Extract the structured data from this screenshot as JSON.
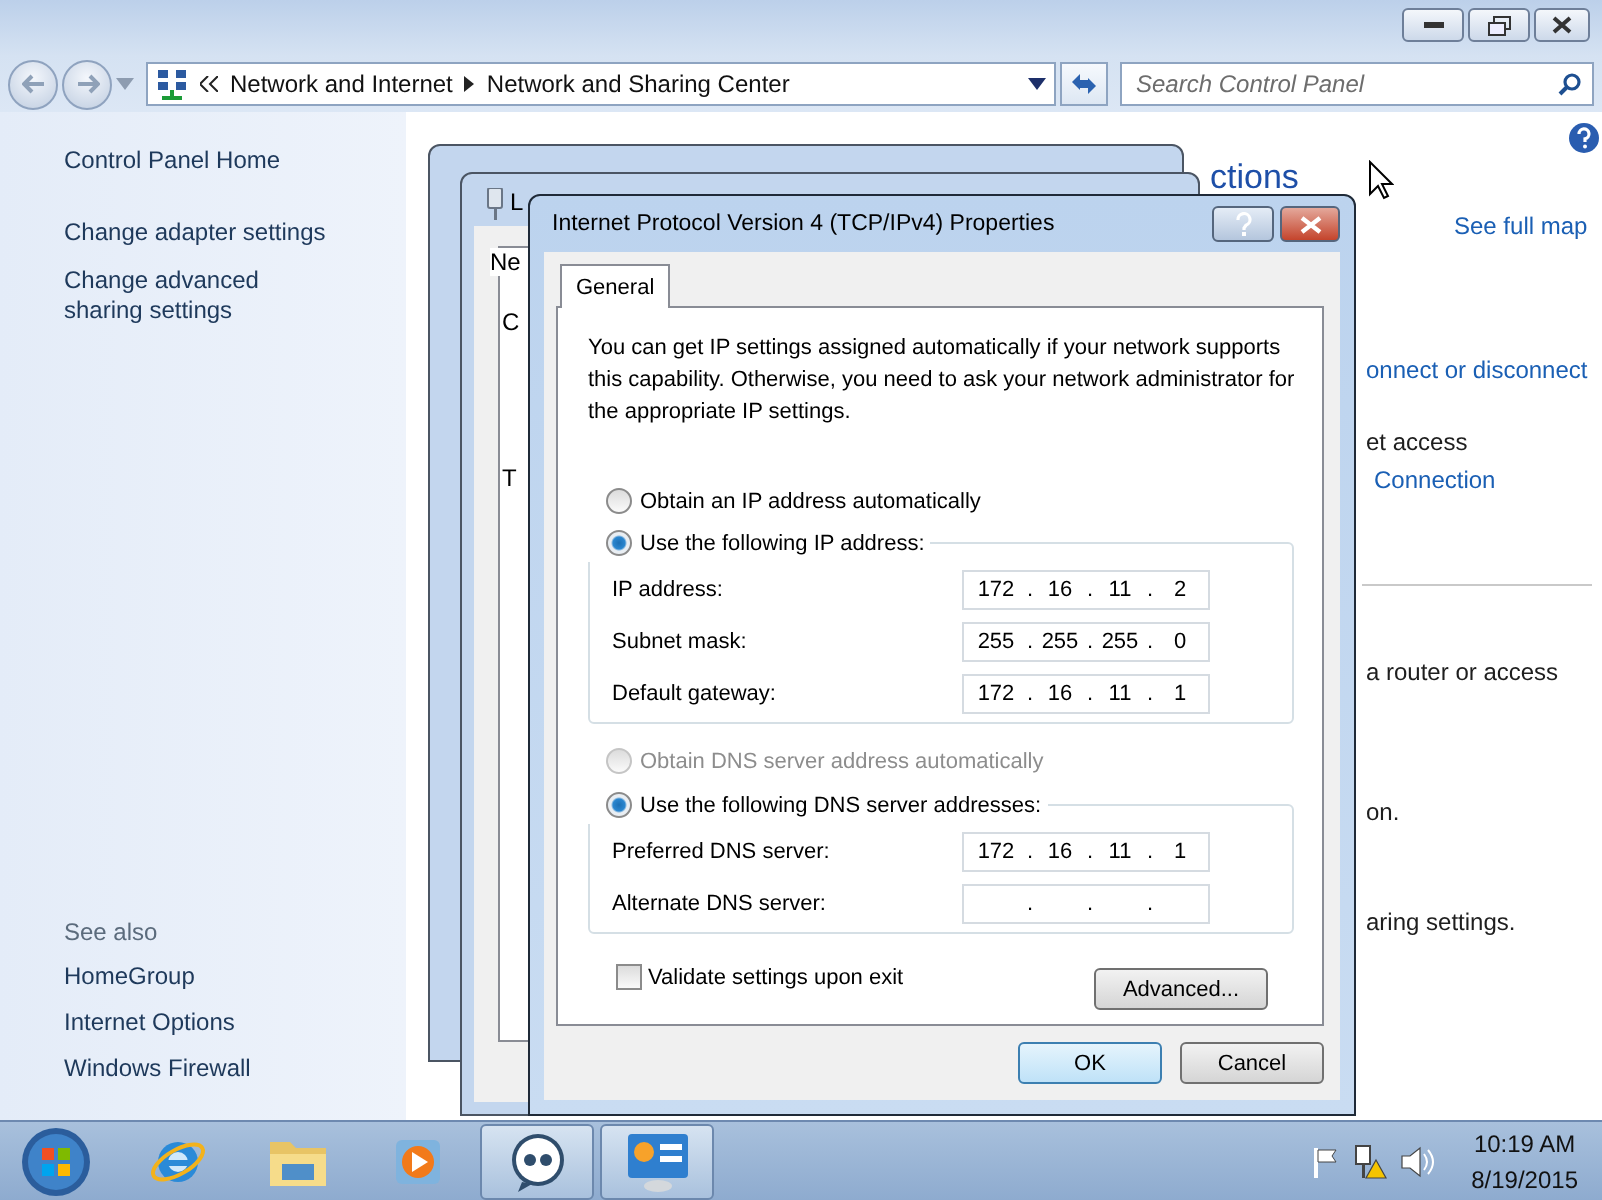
{
  "explorer": {
    "breadcrumb": [
      "Network and Internet",
      "Network and Sharing Center"
    ],
    "search": {
      "placeholder": "Search Control Panel"
    },
    "sidebar": {
      "links": [
        "Control Panel Home",
        "Change adapter settings",
        "Change advanced sharing settings"
      ],
      "see_also_title": "See also",
      "see_also": [
        "HomeGroup",
        "Internet Options",
        "Windows Firewall"
      ]
    },
    "main_fragments": [
      {
        "kind": "heading",
        "text": "ctions"
      },
      {
        "kind": "link",
        "text": "See full map"
      },
      {
        "kind": "link",
        "text": "onnect or disconnect"
      },
      {
        "kind": "text",
        "text": "et access"
      },
      {
        "kind": "link",
        "text": "Connection"
      },
      {
        "kind": "rule"
      },
      {
        "kind": "text",
        "text": "a router or access"
      },
      {
        "kind": "text",
        "text": "on."
      },
      {
        "kind": "text",
        "text": "aring settings."
      }
    ]
  },
  "background_window": {
    "title": "L",
    "tab": "Ne",
    "labels": [
      "C",
      "T"
    ]
  },
  "dialog": {
    "title": "Internet Protocol Version 4 (TCP/IPv4) Properties",
    "tabs": [
      {
        "label": "General",
        "selected": true
      }
    ],
    "description": "You can get IP settings assigned automatically if your network supports this capability. Otherwise, you need to ask your network administrator for the appropriate IP settings.",
    "separator": ".",
    "ip_group": {
      "auto": {
        "label": "Obtain an IP address automatically",
        "selected": false,
        "disabled": false
      },
      "manual": {
        "label": "Use the following IP address:",
        "selected": true,
        "disabled": false
      },
      "fields": [
        {
          "label": "IP address:",
          "octets": [
            "172",
            "16",
            "11",
            "2"
          ]
        },
        {
          "label": "Subnet mask:",
          "octets": [
            "255",
            "255",
            "255",
            "0"
          ]
        },
        {
          "label": "Default gateway:",
          "octets": [
            "172",
            "16",
            "11",
            "1"
          ]
        }
      ]
    },
    "dns_group": {
      "auto": {
        "label": "Obtain DNS server address automatically",
        "selected": false,
        "disabled": true
      },
      "manual": {
        "label": "Use the following DNS server addresses:",
        "selected": true,
        "disabled": false
      },
      "fields": [
        {
          "label": "Preferred DNS server:",
          "octets": [
            "172",
            "16",
            "11",
            "1"
          ]
        },
        {
          "label": "Alternate DNS server:",
          "blank": true
        }
      ]
    },
    "validate": {
      "label": "Validate settings upon exit",
      "checked": false
    },
    "advanced_button": "Advanced...",
    "buttons": [
      {
        "label": "OK",
        "default": true
      },
      {
        "label": "Cancel",
        "default": false
      }
    ]
  },
  "taskbar": {
    "items": [
      {
        "kind": "browser",
        "open": false
      },
      {
        "kind": "folder",
        "open": false
      },
      {
        "kind": "media",
        "open": false
      },
      {
        "kind": "chat",
        "open": true
      },
      {
        "kind": "control-panel",
        "open": true
      }
    ],
    "time": "10:19 AM",
    "date": "8/19/2015"
  }
}
